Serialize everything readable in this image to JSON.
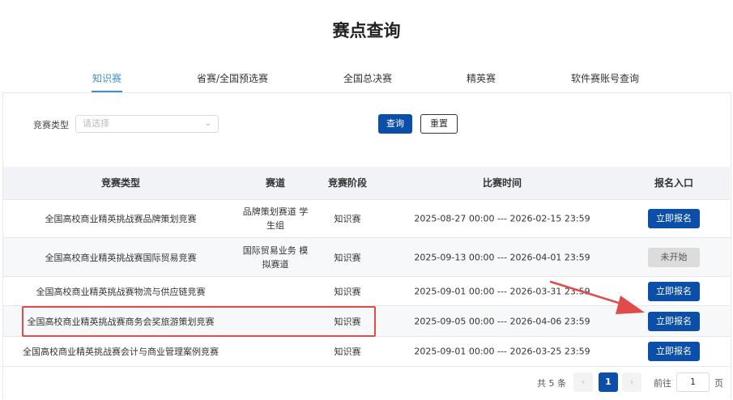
{
  "page": {
    "title": "赛点查询"
  },
  "tabs": [
    {
      "label": "知识赛",
      "active": true
    },
    {
      "label": "省赛/全国预选赛",
      "active": false
    },
    {
      "label": "全国总决赛",
      "active": false
    },
    {
      "label": "精英赛",
      "active": false
    },
    {
      "label": "软件赛账号查询",
      "active": false
    }
  ],
  "filter": {
    "label": "竞赛类型",
    "placeholder": "请选择",
    "query_label": "查询",
    "reset_label": "重置"
  },
  "table": {
    "headers": [
      "竞赛类型",
      "赛道",
      "竞赛阶段",
      "比赛时间",
      "报名入口"
    ],
    "rows": [
      {
        "type": "全国高校商业精英挑战赛品牌策划竞赛",
        "track": "品牌策划赛道 学生组",
        "stage": "知识赛",
        "time": "2025-08-27 00:00 --- 2026-02-15 23:59",
        "action": "立即报名",
        "status": "open"
      },
      {
        "type": "全国高校商业精英挑战赛国际贸易竞赛",
        "track": "国际贸易业务 模拟赛道",
        "stage": "知识赛",
        "time": "2025-09-13 00:00 --- 2026-04-01 23:59",
        "action": "未开始",
        "status": "closed"
      },
      {
        "type": "全国高校商业精英挑战赛物流与供应链竞赛",
        "track": "",
        "stage": "知识赛",
        "time": "2025-09-01 00:00 --- 2026-03-31 23:59",
        "action": "立即报名",
        "status": "open"
      },
      {
        "type": "全国高校商业精英挑战赛商务会奖旅游策划竞赛",
        "track": "",
        "stage": "知识赛",
        "time": "2025-09-05 00:00 --- 2026-04-06 23:59",
        "action": "立即报名",
        "status": "open"
      },
      {
        "type": "全国高校商业精英挑战赛会计与商业管理案例竞赛",
        "track": "",
        "stage": "知识赛",
        "time": "2025-09-01 00:00 --- 2026-03-25 23:59",
        "action": "立即报名",
        "status": "open"
      }
    ]
  },
  "pagination": {
    "total": "共 5 条",
    "prev": "‹",
    "current": "1",
    "next": "›",
    "goto_label": "前往",
    "goto_value": "1",
    "page_suffix": "页"
  },
  "colors": {
    "primary": "#0b4fa8",
    "active_tab": "#3f8fcf",
    "annotation": "#e04b4b"
  },
  "icons": {
    "select_chevron": "chevron-down-icon"
  }
}
